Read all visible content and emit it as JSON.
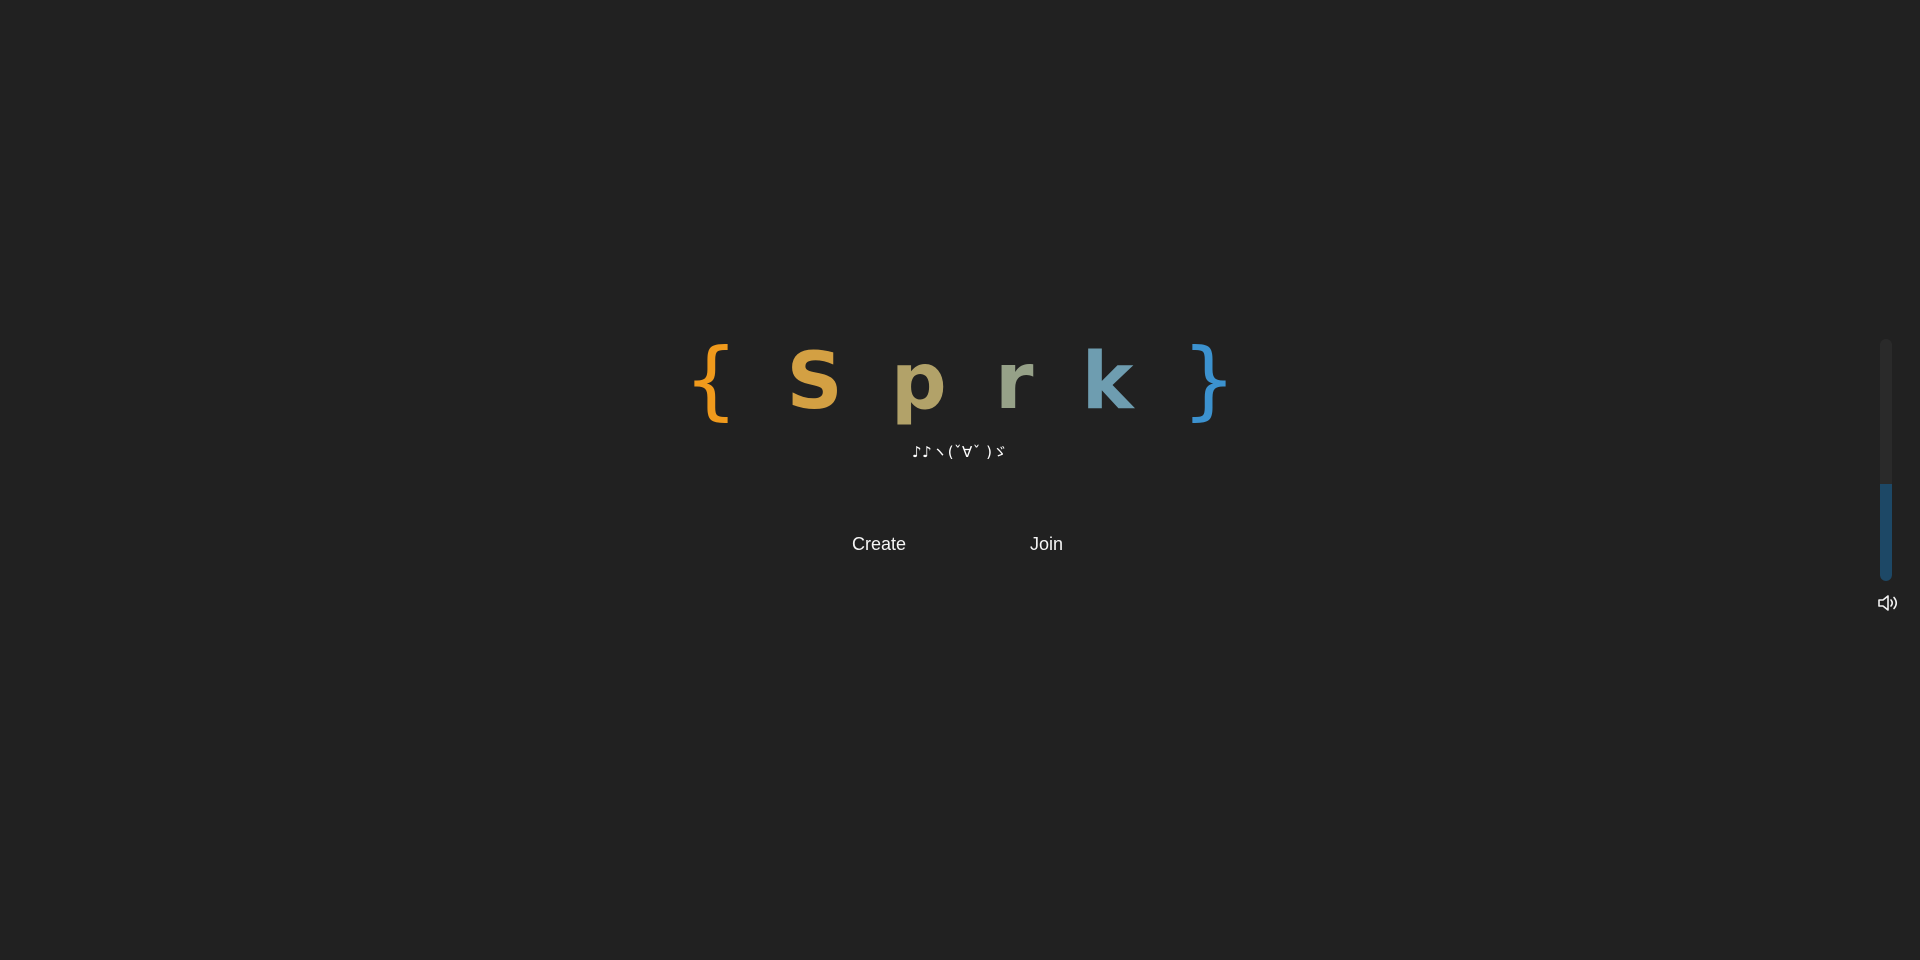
{
  "brand": {
    "open_brace": "{",
    "letters": [
      "S",
      "p",
      "r",
      "k"
    ],
    "close_brace": "}",
    "colors": {
      "open_brace": "#F09A1C",
      "S": "#D3A043",
      "p": "#B2A269",
      "r": "#96A188",
      "k": "#6E9DB0",
      "close_brace": "#3C92CF"
    }
  },
  "subtitle": "♪♪ヽ(ˇ∀ˇ )ゞ",
  "actions": {
    "create_label": "Create",
    "join_label": "Join"
  },
  "volume": {
    "icon": "volume-icon",
    "level": 0.4
  }
}
